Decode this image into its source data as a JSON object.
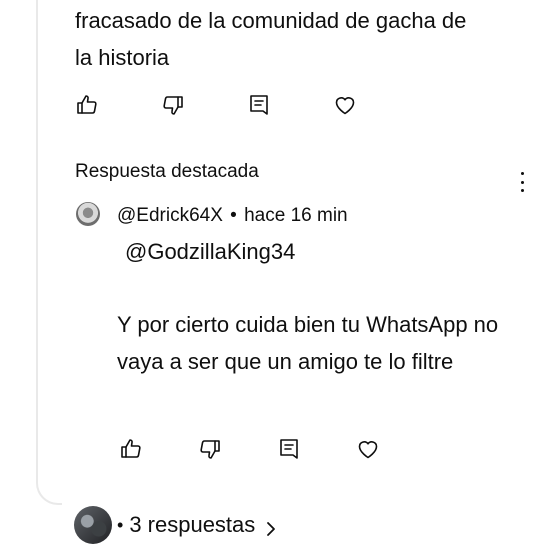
{
  "comment": {
    "text_lines": "fracasado de la comunidad de gacha de\nla historia",
    "actions": [
      "like-icon",
      "dislike-icon",
      "reply-icon",
      "heart-icon"
    ]
  },
  "featured_reply": {
    "label": "Respuesta destacada",
    "menu_icon": "more-vert-icon",
    "author": "@Edrick64X",
    "separator": "•",
    "time": "hace 16 min",
    "mention": "@GodzillaKing34",
    "body": "Y por cierto cuida bien tu WhatsApp no vaya a ser que un amigo te lo filtre",
    "actions": [
      "like-icon",
      "dislike-icon",
      "reply-icon",
      "heart-icon"
    ]
  },
  "replies": {
    "dot": "•",
    "count_label": "3 respuestas",
    "chevron_icon": "chevron-right-icon"
  }
}
